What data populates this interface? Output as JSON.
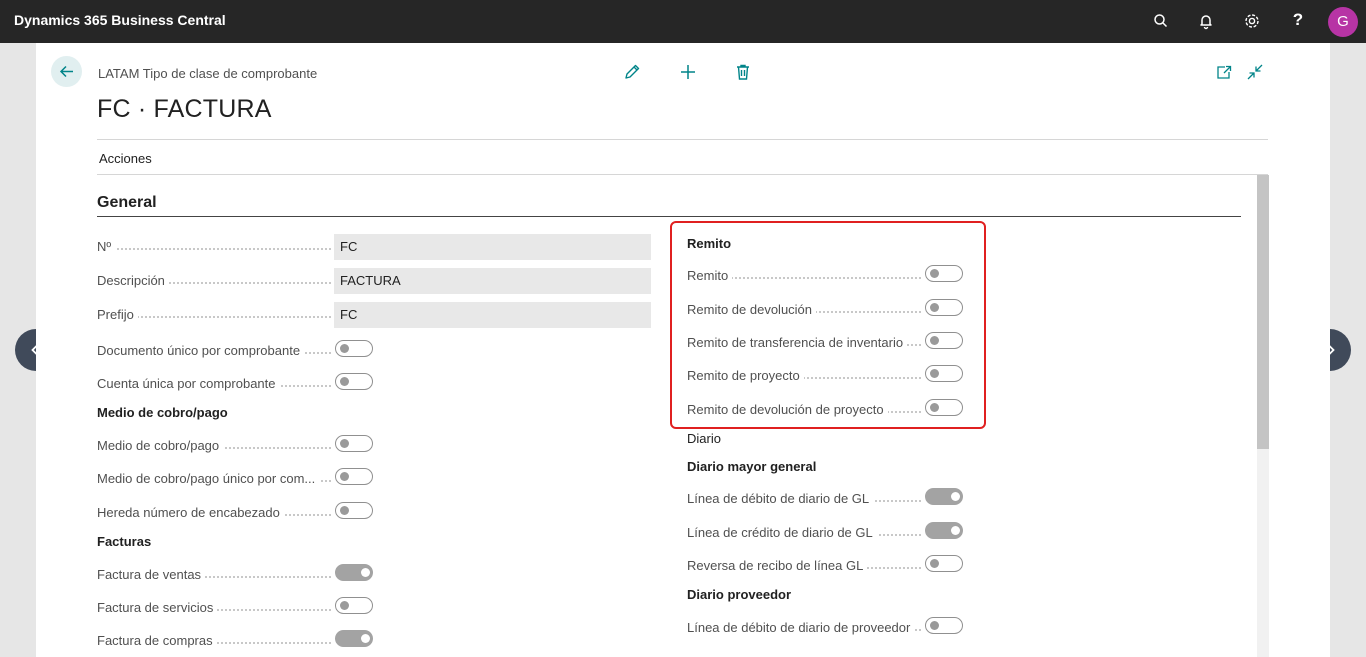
{
  "app": {
    "title": "Dynamics 365 Business Central",
    "avatar_initial": "G",
    "help_label": "?"
  },
  "topbar_icons": [
    "search-icon",
    "bell-icon",
    "settings-icon",
    "help-icon"
  ],
  "page": {
    "breadcrumb": "LATAM Tipo de clase de comprobante",
    "title": "FC · FACTURA",
    "menu_acciones": "Acciones",
    "section_title": "General"
  },
  "left": {
    "fields": [
      {
        "label": "Nº",
        "value": "FC"
      },
      {
        "label": "Descripción",
        "value": "FACTURA"
      },
      {
        "label": "Prefijo",
        "value": "FC"
      }
    ],
    "toggles_top": [
      {
        "label": "Documento único por comprobante",
        "on": false
      },
      {
        "label": "Cuenta única por comprobante",
        "on": false
      }
    ],
    "group_medio": "Medio de cobro/pago",
    "toggles_medio": [
      {
        "label": "Medio de cobro/pago",
        "on": false
      },
      {
        "label": "Medio de cobro/pago único por com...",
        "on": false
      },
      {
        "label": "Hereda número de encabezado",
        "on": false
      }
    ],
    "group_facturas": "Facturas",
    "toggles_facturas": [
      {
        "label": "Factura de ventas",
        "on": true
      },
      {
        "label": "Factura de servicios",
        "on": false
      },
      {
        "label": "Factura de compras",
        "on": true
      }
    ]
  },
  "right": {
    "group_remito": "Remito",
    "toggles_remito": [
      {
        "label": "Remito",
        "on": false
      },
      {
        "label": "Remito de devolución",
        "on": false
      },
      {
        "label": "Remito de transferencia de inventario",
        "on": false
      },
      {
        "label": "Remito de proyecto",
        "on": false
      },
      {
        "label": "Remito de devolución de proyecto",
        "on": false
      }
    ],
    "group_diario": "Diario",
    "group_diario_mayor": "Diario mayor general",
    "toggles_diario_mayor": [
      {
        "label": "Línea de débito de diario de GL",
        "on": true
      },
      {
        "label": "Línea de crédito de diario de GL",
        "on": true
      },
      {
        "label": "Reversa de recibo de línea GL",
        "on": false
      }
    ],
    "group_diario_proveedor": "Diario proveedor",
    "toggles_diario_proveedor": [
      {
        "label": "Línea de débito de diario de proveedor",
        "on": false
      }
    ]
  },
  "colors": {
    "topbar": "#262626",
    "accent": "#008489",
    "avatar": "#b734a5",
    "highlight": "#e02020"
  }
}
